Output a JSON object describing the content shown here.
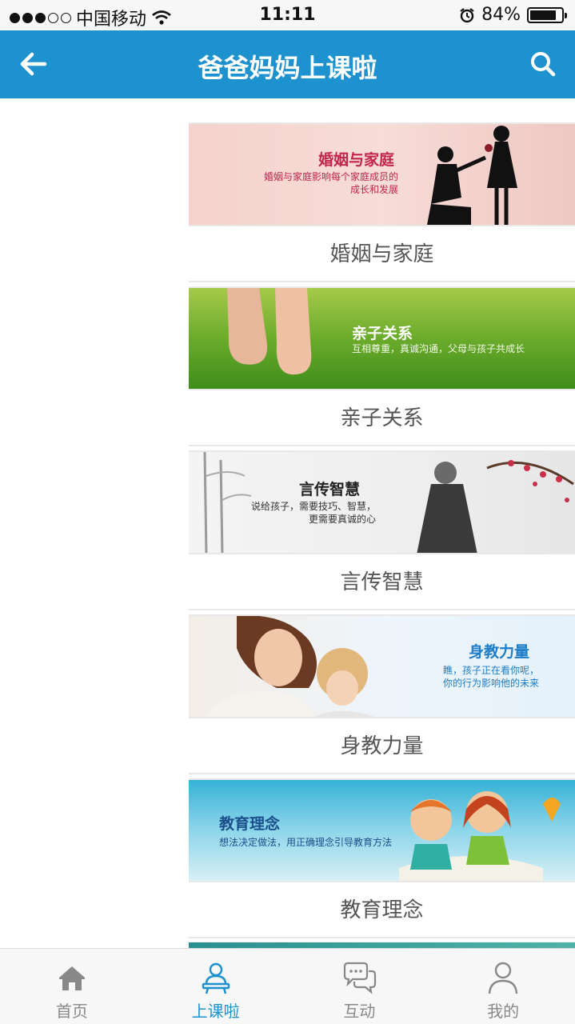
{
  "status_bar": {
    "carrier": "中国移动",
    "time": "11:11",
    "battery_percent": "84%",
    "battery_level": 0.84
  },
  "header": {
    "title": "爸爸妈妈上课啦",
    "back_icon": "arrow-left-icon",
    "search_icon": "search-icon"
  },
  "courses": [
    {
      "label": "婚姻与家庭",
      "banner_title": "婚姻与家庭",
      "banner_subtitle": [
        "婚姻与家庭影响每个家庭成员的",
        "成长和发展"
      ]
    },
    {
      "label": "亲子关系",
      "banner_title": "亲子关系",
      "banner_subtitle": [
        "互相尊重，真诚沟通，父母与孩子共成长"
      ]
    },
    {
      "label": "言传智慧",
      "banner_title": "言传智慧",
      "banner_subtitle": [
        "说给孩子，需要技巧、智慧，",
        "更需要真诚的心"
      ]
    },
    {
      "label": "身教力量",
      "banner_title": "身教力量",
      "banner_subtitle": [
        "瞧，孩子正在看你呢，",
        "你的行为影响他的未来"
      ]
    },
    {
      "label": "教育理念",
      "banner_title": "教育理念",
      "banner_subtitle": [
        "想法决定做法，用正确理念引导教育方法"
      ]
    }
  ],
  "tabs": [
    {
      "label": "首页",
      "icon": "home-icon"
    },
    {
      "label": "上课啦",
      "icon": "teacher-icon",
      "active": true
    },
    {
      "label": "互动",
      "icon": "chat-bubbles-icon"
    },
    {
      "label": "我的",
      "icon": "person-icon"
    }
  ],
  "colors": {
    "accent": "#1e91cf",
    "tab_inactive": "#888888"
  }
}
